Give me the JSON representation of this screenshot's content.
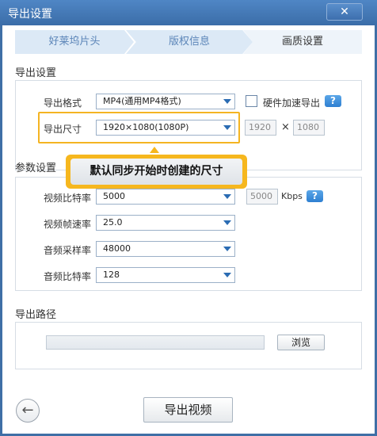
{
  "window": {
    "title": "导出设置",
    "close_label": "✕"
  },
  "tabs": [
    {
      "label": "好莱坞片头"
    },
    {
      "label": "版权信息"
    },
    {
      "label": "画质设置"
    }
  ],
  "export_settings": {
    "title": "导出设置",
    "format_label": "导出格式",
    "format_value": "MP4(通用MP4格式)",
    "hw_accel_label": "硬件加速导出",
    "help_label": "?",
    "size_label": "导出尺寸",
    "size_value": "1920×1080(1080P)",
    "width_value": "1920",
    "times": "×",
    "height_value": "1080"
  },
  "tooltip": {
    "text": "默认同步开始时创建的尺寸"
  },
  "params": {
    "title": "参数设置",
    "video_bitrate_label": "视频比特率",
    "video_bitrate_value": "5000",
    "video_bitrate_input": "5000",
    "kbps": "Kbps",
    "framerate_label": "视频帧速率",
    "framerate_value": "25.0",
    "samplerate_label": "音频采样率",
    "samplerate_value": "48000",
    "audio_bitrate_label": "音频比特率",
    "audio_bitrate_value": "128",
    "help_label": "?"
  },
  "path": {
    "title": "导出路径",
    "value": "",
    "browse_label": "浏览"
  },
  "footer": {
    "back_icon": "back-arrow-icon",
    "export_label": "导出视频"
  }
}
